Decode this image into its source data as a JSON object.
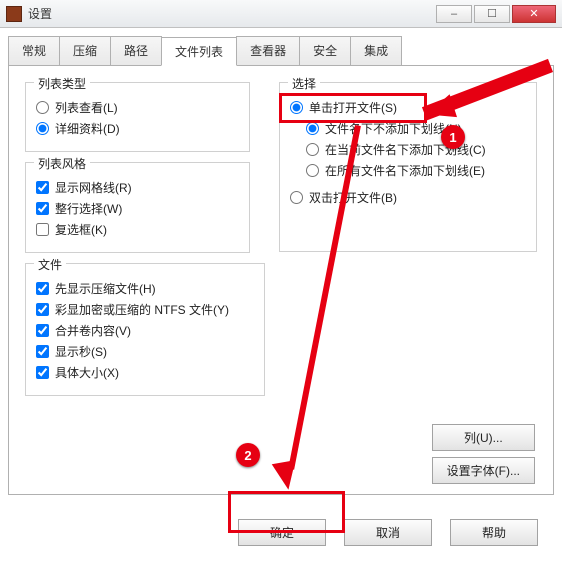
{
  "window": {
    "title": "设置"
  },
  "tabs": [
    "常规",
    "压缩",
    "路径",
    "文件列表",
    "查看器",
    "安全",
    "集成"
  ],
  "groups": {
    "listType": {
      "title": "列表类型",
      "opts": [
        {
          "label": "列表查看(L)",
          "checked": false
        },
        {
          "label": "详细资料(D)",
          "checked": true
        }
      ]
    },
    "listStyle": {
      "title": "列表风格",
      "opts": [
        {
          "label": "显示网格线(R)",
          "checked": true
        },
        {
          "label": "整行选择(W)",
          "checked": true
        },
        {
          "label": "复选框(K)",
          "checked": false
        }
      ]
    },
    "file": {
      "title": "文件",
      "opts": [
        {
          "label": "先显示压缩文件(H)",
          "checked": true
        },
        {
          "label": "彩显加密或压缩的 NTFS 文件(Y)",
          "checked": true
        },
        {
          "label": "合并卷内容(V)",
          "checked": true
        },
        {
          "label": "显示秒(S)",
          "checked": true
        },
        {
          "label": "具体大小(X)",
          "checked": true
        }
      ]
    },
    "select": {
      "title": "选择",
      "opts": [
        {
          "label": "单击打开文件(S)",
          "checked": true
        },
        {
          "label": "文件名下不添加下划线(N)",
          "checked": true,
          "sub": true
        },
        {
          "label": "在当前文件名下添加下划线(C)",
          "checked": false,
          "sub": true
        },
        {
          "label": "在所有文件名下添加下划线(E)",
          "checked": false,
          "sub": true
        },
        {
          "label": "双击打开文件(B)",
          "checked": false
        }
      ]
    }
  },
  "sideButtons": {
    "col": "列(U)...",
    "font": "设置字体(F)..."
  },
  "bottom": {
    "ok": "确定",
    "cancel": "取消",
    "help": "帮助"
  },
  "badges": {
    "b1": "1",
    "b2": "2"
  }
}
